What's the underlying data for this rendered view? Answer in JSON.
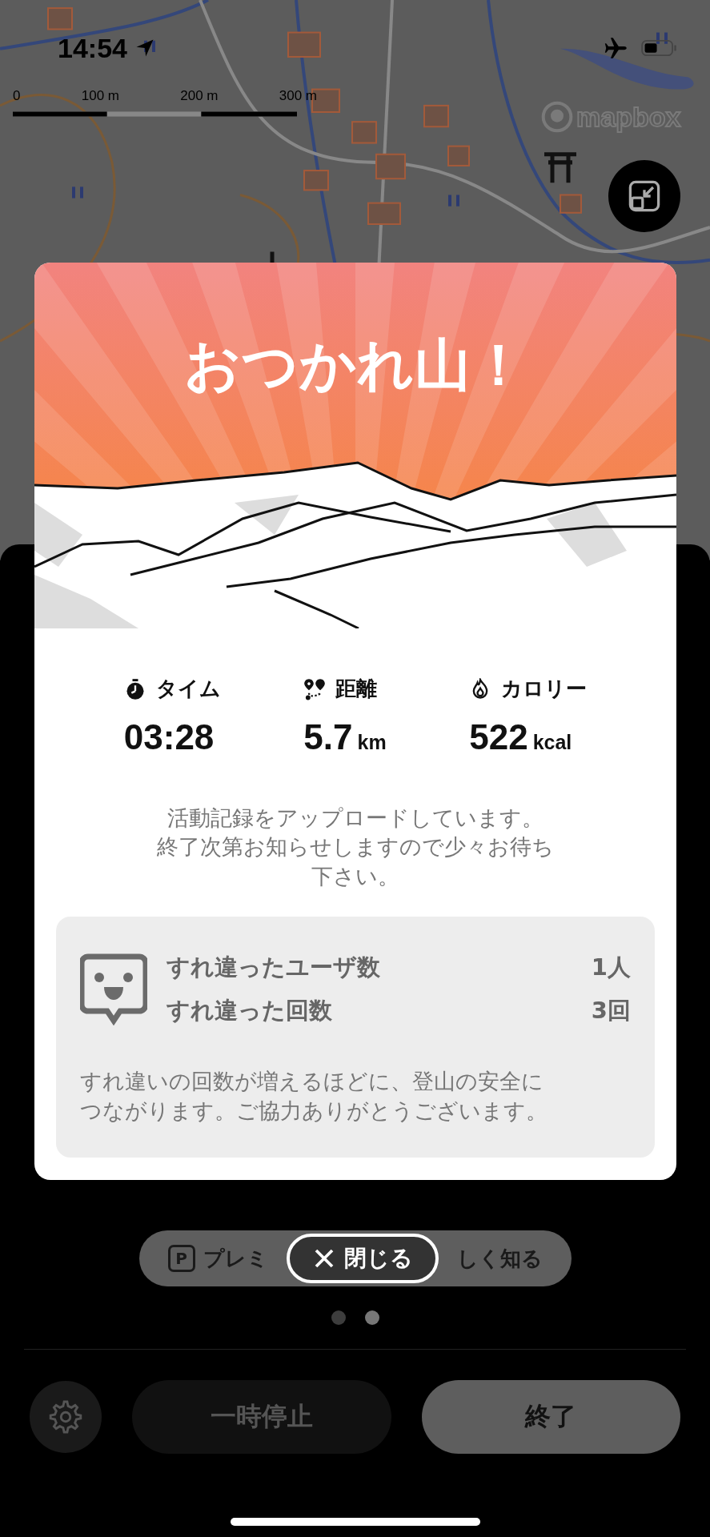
{
  "status_bar": {
    "time": "14:54"
  },
  "map": {
    "scale_labels": [
      "0",
      "100 m",
      "200 m",
      "300 m"
    ],
    "attribution": "mapbox"
  },
  "modal": {
    "title": "おつかれ山！",
    "stats": [
      {
        "kind": "time",
        "label": "タイム",
        "value": "03:28"
      },
      {
        "kind": "distance",
        "label": "距離",
        "value": "5.7",
        "unit": "km"
      },
      {
        "kind": "calories",
        "label": "カロリー",
        "value": "522",
        "unit": "kcal"
      }
    ],
    "message_lines": [
      "活動記録をアップロードしています。",
      "終了次第お知らせしますので少々お待ち",
      "下さい。"
    ],
    "encounters": {
      "rows": [
        {
          "label": "すれ違ったユーザ数",
          "value": "1人"
        },
        {
          "label": "すれ違った回数",
          "value": "3回"
        }
      ],
      "note_lines": [
        "すれ違いの回数が増えるほどに、登山の安全に",
        "つながります。ご協力ありがとうございます。"
      ]
    }
  },
  "close_button": "閉じる",
  "premium_button": {
    "icon_letter": "P",
    "label_start": "プレミ",
    "label_end": "しく知る"
  },
  "page_dots": [
    {
      "selected": false
    },
    {
      "selected": true
    }
  ],
  "controls": {
    "pause": "一時停止",
    "finish": "終了"
  }
}
